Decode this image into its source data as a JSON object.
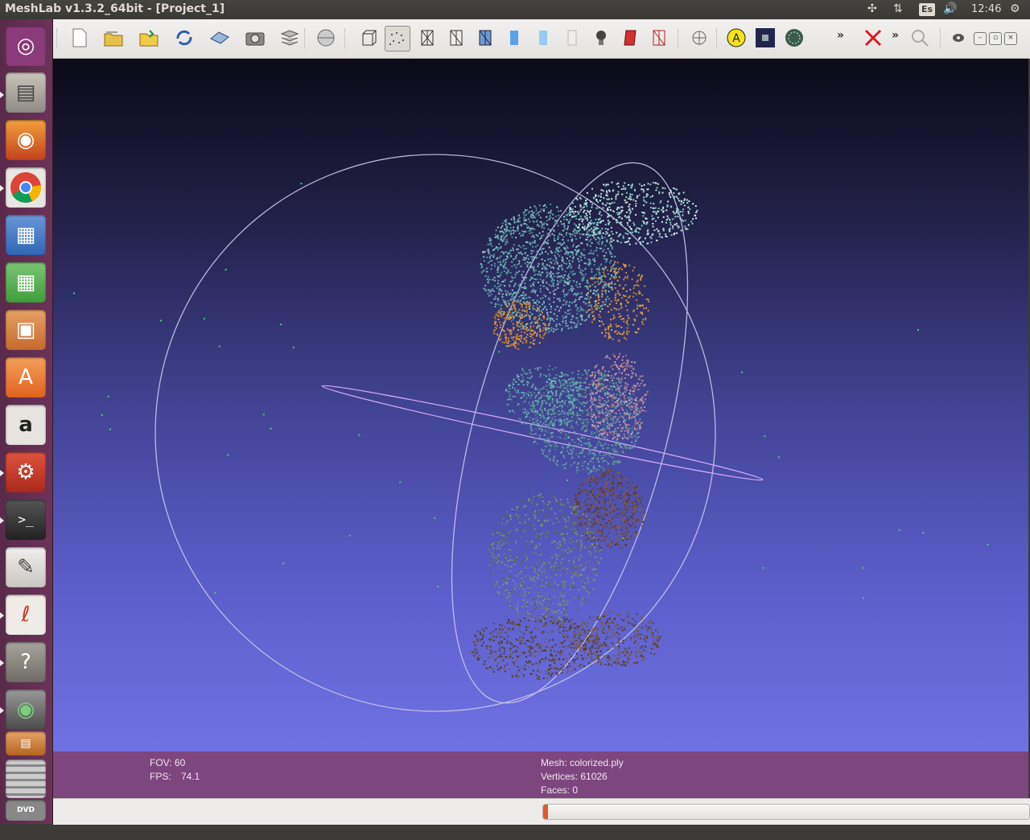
{
  "window": {
    "title": "MeshLab v1.3.2_64bit - [Project_1]"
  },
  "panel": {
    "indicators": [
      "network-icon",
      "transfer-icon",
      "keyboard-layout",
      "volume-icon",
      "clock",
      "settings-gear-icon"
    ],
    "keyboard_layout": "Es",
    "clock": "12:46"
  },
  "launcher": {
    "apps": [
      {
        "name": "ubuntu-dash",
        "icon": "ubuntu-logo-icon",
        "color": "#8b3a7a"
      },
      {
        "name": "files",
        "icon": "file-cabinet-icon",
        "color": "#a29d96"
      },
      {
        "name": "firefox",
        "icon": "firefox-icon",
        "color": "#e66d24"
      },
      {
        "name": "chrome",
        "icon": "chrome-icon",
        "color": "#4a8fe0"
      },
      {
        "name": "libreoffice-writer",
        "icon": "writer-doc-icon",
        "color": "#2f66b3"
      },
      {
        "name": "libreoffice-calc",
        "icon": "calc-sheet-icon",
        "color": "#3f9d3a"
      },
      {
        "name": "libreoffice-impress",
        "icon": "impress-slide-icon",
        "color": "#c56a2d"
      },
      {
        "name": "software-center",
        "icon": "shopping-bag-icon",
        "color": "#e6782a"
      },
      {
        "name": "amazon",
        "icon": "amazon-icon",
        "color": "#e7e4df"
      },
      {
        "name": "system-settings",
        "icon": "settings-wrench-icon",
        "color": "#c73a2a"
      },
      {
        "name": "terminal",
        "icon": "terminal-icon",
        "color": "#2b2b2b"
      },
      {
        "name": "text-editor",
        "icon": "text-editor-icon",
        "color": "#dcdad5"
      },
      {
        "name": "pdf-viewer",
        "icon": "pdf-icon",
        "color": "#e9e5df"
      },
      {
        "name": "help",
        "icon": "help-icon",
        "color": "#8a8780"
      },
      {
        "name": "meshlab",
        "icon": "eye-icon",
        "color": "#6e6e6e"
      },
      {
        "name": "workspaces",
        "icon": "workspaces-icon",
        "color": "#8a8780"
      },
      {
        "name": "trash",
        "icon": "trash-icon",
        "color": "#777"
      },
      {
        "name": "dvd",
        "icon": "dvd-icon",
        "color": "#777"
      }
    ]
  },
  "toolbar": {
    "buttons": [
      "new-project-icon",
      "open-project-icon",
      "import-mesh-icon",
      "reload-icon",
      "export-mesh-icon",
      "snapshot-icon",
      "layers-icon",
      "render-sphere-icon",
      "bbox-render-icon",
      "points-render-icon",
      "wireframe-render-icon",
      "hidden-lines-icon",
      "flat-lines-icon",
      "flat-render-icon",
      "smooth-render-icon",
      "texture-render-icon",
      "light-bulb-icon",
      "backface-icon",
      "selected-faces-icon",
      "trackball-icon",
      "annotate-icon",
      "photo-raster-icon",
      "dot-pattern-icon",
      "more-chevron",
      "cancel-red-x-icon",
      "more-chevron-2",
      "search-zoom-icon",
      "window-eye-icon"
    ],
    "selected": "points-render-icon",
    "accent": "#e05a2b"
  },
  "info": {
    "fov_label": "FOV: 60",
    "fps_label": "FPS:",
    "fps_value": "74.1",
    "mesh_label": "Mesh: colorized.ply",
    "vertices_label": "Vertices: 61026",
    "faces_label": "Faces: 0"
  },
  "status": {
    "progress_fraction": 0.004
  }
}
